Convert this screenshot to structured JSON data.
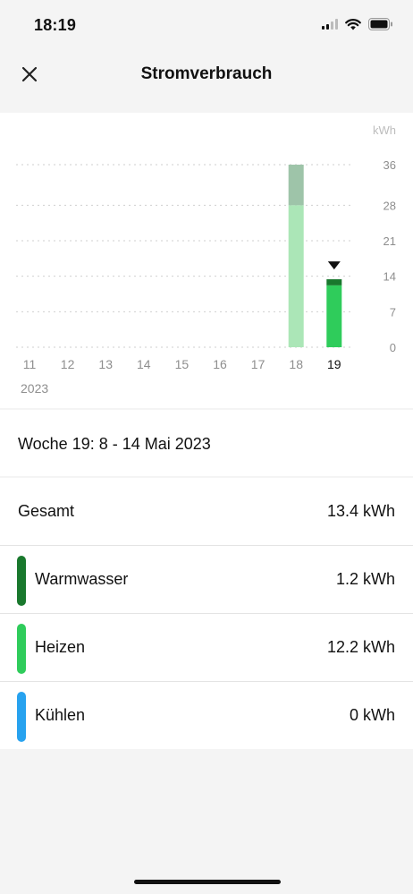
{
  "status_bar": {
    "time": "18:19"
  },
  "header": {
    "title": "Stromverbrauch",
    "close_icon": "close-icon"
  },
  "chart_data": {
    "type": "bar",
    "unit_label": "kWh",
    "categories": [
      "11",
      "12",
      "13",
      "14",
      "15",
      "16",
      "17",
      "18",
      "19"
    ],
    "year_label": "2023",
    "selected_category": "19",
    "yticks": [
      0,
      7,
      14,
      21,
      28,
      36
    ],
    "ylim": [
      0,
      36
    ],
    "grid": true,
    "series": [
      {
        "name": "Heizen",
        "values": [
          0,
          0,
          0,
          0,
          0,
          0,
          0,
          28,
          12.2
        ]
      },
      {
        "name": "Warmwasser",
        "values": [
          0,
          0,
          0,
          0,
          0,
          0,
          0,
          8,
          1.2
        ]
      }
    ],
    "colors": {
      "heizen": "#2fcc5b",
      "heizen_faded": "#abe6b7",
      "warmwasser": "#19782d",
      "warmwasser_faded": "#9ec4a9",
      "grid": "#cfcfcf",
      "tick": "#8e8e8e",
      "axis_unit": "#bdbdbd"
    }
  },
  "week": {
    "label": "Woche 19: 8 - 14 Mai 2023"
  },
  "summary": {
    "total": {
      "label": "Gesamt",
      "value": "13.4 kWh"
    },
    "items": [
      {
        "label": "Warmwasser",
        "value": "1.2 kWh",
        "color": "#19782d"
      },
      {
        "label": "Heizen",
        "value": "12.2 kWh",
        "color": "#2fcc5b"
      },
      {
        "label": "Kühlen",
        "value": "0 kWh",
        "color": "#27a2ef"
      }
    ]
  }
}
